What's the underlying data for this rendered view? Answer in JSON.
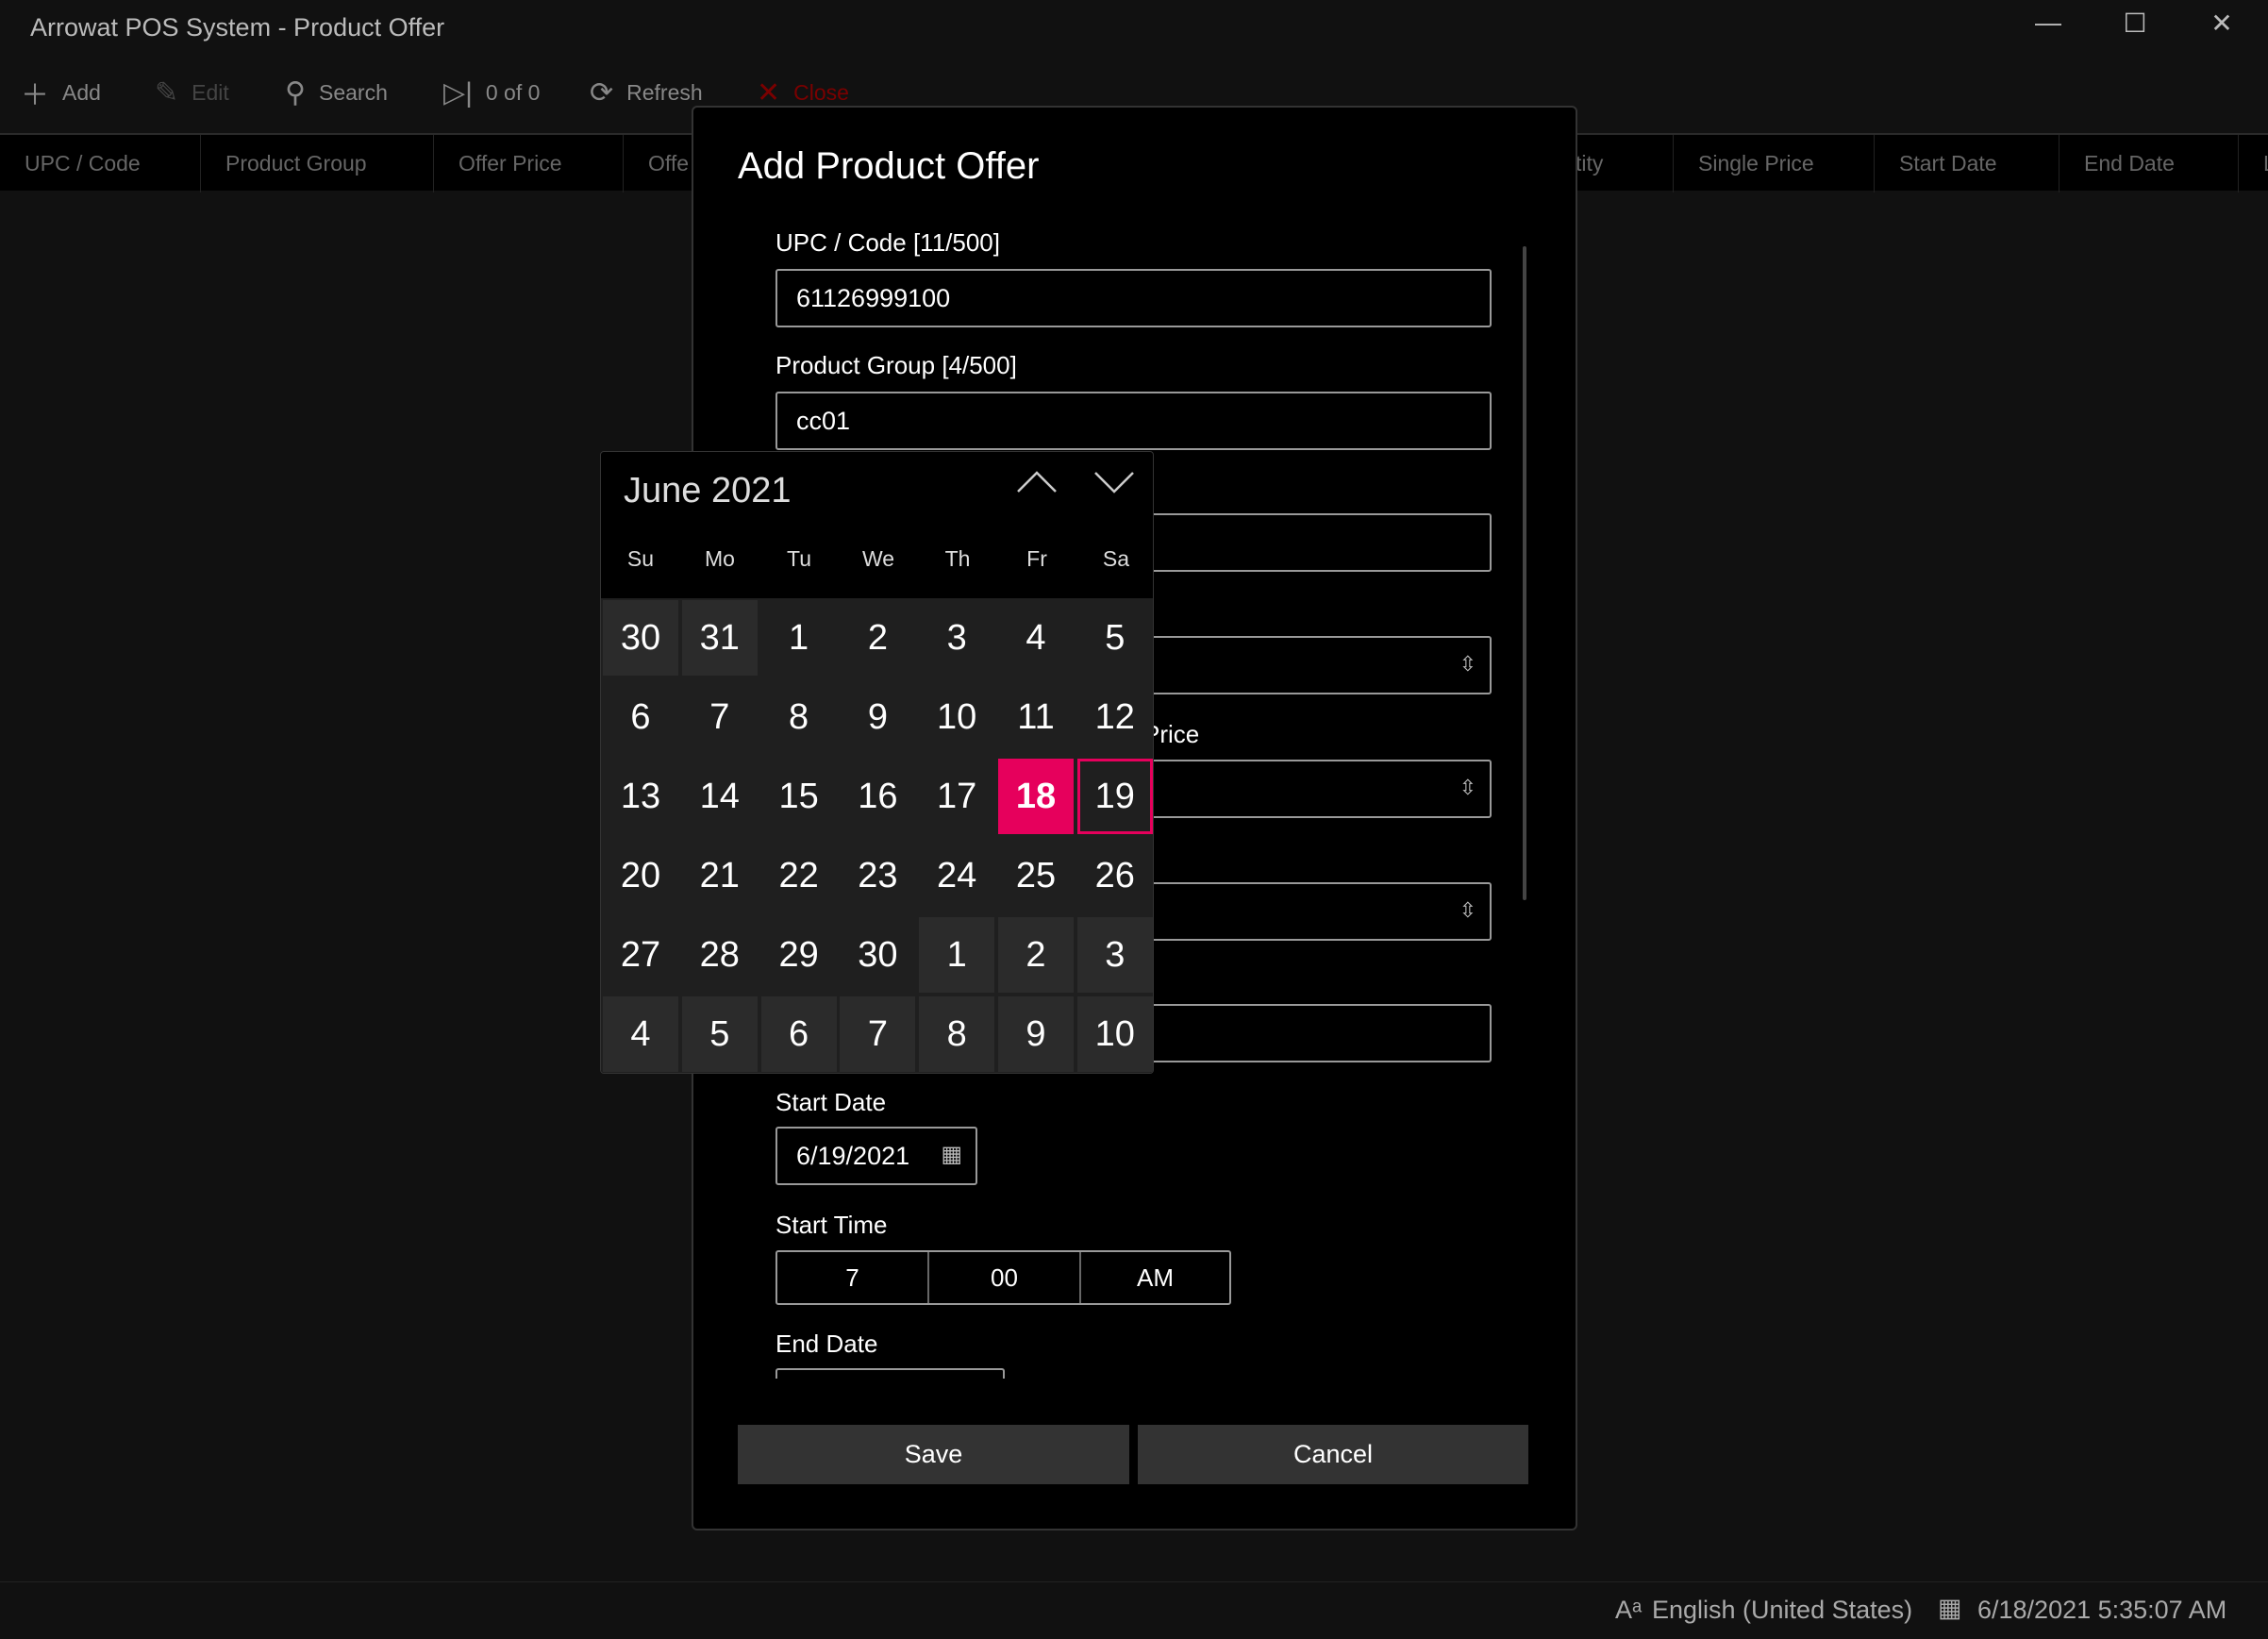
{
  "window": {
    "title": "Arrowat POS System - Product Offer",
    "minimize": "—",
    "maximize": "☐",
    "close": "✕"
  },
  "toolbar": {
    "add": "Add",
    "edit": "Edit",
    "search": "Search",
    "nav": "0 of 0",
    "refresh": "Refresh",
    "close": "Close"
  },
  "columns": [
    "UPC / Code",
    "Product Group",
    "Offer Price",
    "Offe",
    "tity",
    "Single Price",
    "Start Date",
    "End Date",
    "L"
  ],
  "dialog": {
    "title": "Add Product Offer",
    "upc_label": "UPC / Code [11/500]",
    "upc_value": "61126999100",
    "group_label": "Product Group [4/500]",
    "group_value": "cc01",
    "price_label_fragment": "Price",
    "start_date_label": "Start Date",
    "start_date_value": "6/19/2021",
    "start_time_label": "Start Time",
    "hour": "7",
    "minute": "00",
    "ampm": "AM",
    "end_date_label": "End Date",
    "save": "Save",
    "cancel": "Cancel"
  },
  "calendar": {
    "month": "June 2021",
    "days": [
      "Su",
      "Mo",
      "Tu",
      "We",
      "Th",
      "Fr",
      "Sa"
    ],
    "selected": "18",
    "today": "19",
    "accent": "#e6005c",
    "weeks": [
      [
        "30",
        "31",
        "1",
        "2",
        "3",
        "4",
        "5"
      ],
      [
        "6",
        "7",
        "8",
        "9",
        "10",
        "11",
        "12"
      ],
      [
        "13",
        "14",
        "15",
        "16",
        "17",
        "18",
        "19"
      ],
      [
        "20",
        "21",
        "22",
        "23",
        "24",
        "25",
        "26"
      ],
      [
        "27",
        "28",
        "29",
        "30",
        "1",
        "2",
        "3"
      ],
      [
        "4",
        "5",
        "6",
        "7",
        "8",
        "9",
        "10"
      ]
    ]
  },
  "status": {
    "language": "English (United States)",
    "datetime": "6/18/2021 5:35:07 AM"
  }
}
